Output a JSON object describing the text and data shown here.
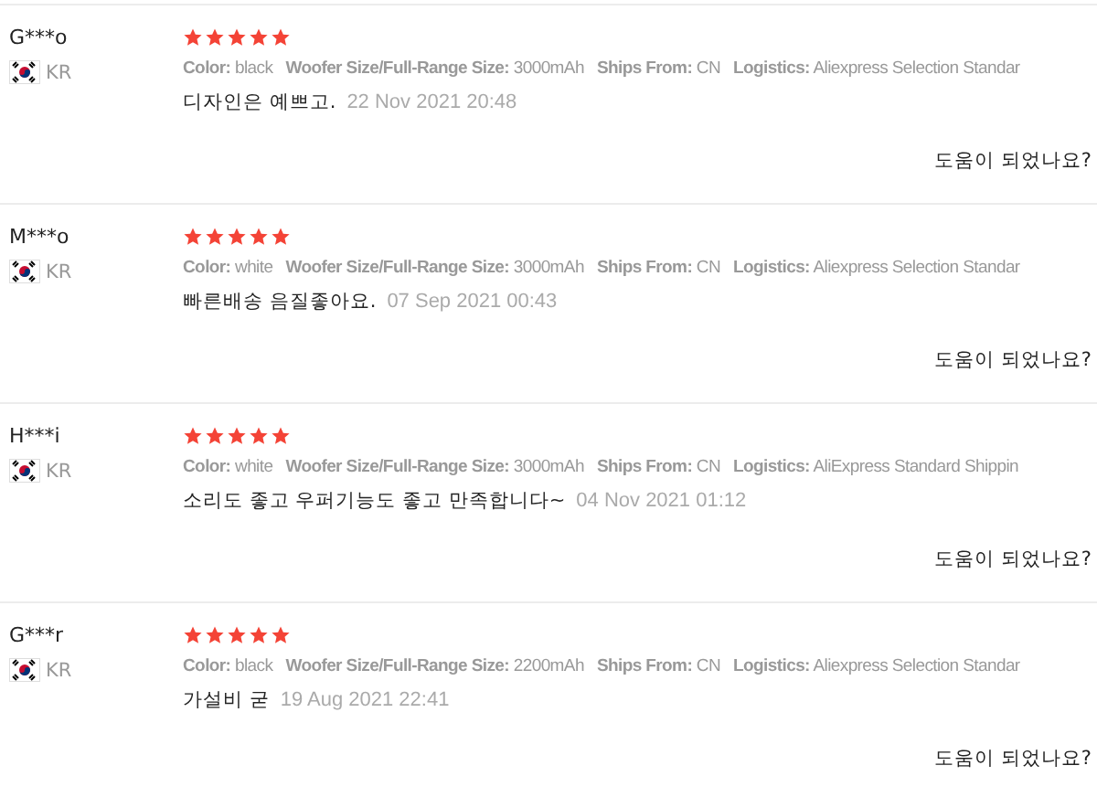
{
  "reviews": [
    {
      "name": "G***o",
      "country": "KR",
      "stars": 5,
      "properties": [
        {
          "label": "Color:",
          "value": "black"
        },
        {
          "label": "Woofer Size/Full-Range Size:",
          "value": "3000mAh"
        },
        {
          "label": "Ships From:",
          "value": "CN"
        },
        {
          "label": "Logistics:",
          "value": "Aliexpress Selection Standar"
        }
      ],
      "comment": "디자인은 예쁘고.",
      "date": "22 Nov 2021 20:48",
      "helpful": "도움이 되었나요?"
    },
    {
      "name": "M***o",
      "country": "KR",
      "stars": 5,
      "properties": [
        {
          "label": "Color:",
          "value": "white"
        },
        {
          "label": "Woofer Size/Full-Range Size:",
          "value": "3000mAh"
        },
        {
          "label": "Ships From:",
          "value": "CN"
        },
        {
          "label": "Logistics:",
          "value": "Aliexpress Selection Standar"
        }
      ],
      "comment": "빠른배송 음질좋아요.",
      "date": "07 Sep 2021 00:43",
      "helpful": "도움이 되었나요?"
    },
    {
      "name": "H***i",
      "country": "KR",
      "stars": 5,
      "properties": [
        {
          "label": "Color:",
          "value": "white"
        },
        {
          "label": "Woofer Size/Full-Range Size:",
          "value": "3000mAh"
        },
        {
          "label": "Ships From:",
          "value": "CN"
        },
        {
          "label": "Logistics:",
          "value": "AliExpress Standard Shippin"
        }
      ],
      "comment": "소리도 좋고 우퍼기능도 좋고 만족합니다~",
      "date": "04 Nov 2021 01:12",
      "helpful": "도움이 되었나요?"
    },
    {
      "name": "G***r",
      "country": "KR",
      "stars": 5,
      "properties": [
        {
          "label": "Color:",
          "value": "black"
        },
        {
          "label": "Woofer Size/Full-Range Size:",
          "value": "2200mAh"
        },
        {
          "label": "Ships From:",
          "value": "CN"
        },
        {
          "label": "Logistics:",
          "value": "Aliexpress Selection Standar"
        }
      ],
      "comment": "가설비 굳",
      "date": "19 Aug 2021 22:41",
      "helpful": "도움이 되었나요?"
    }
  ]
}
